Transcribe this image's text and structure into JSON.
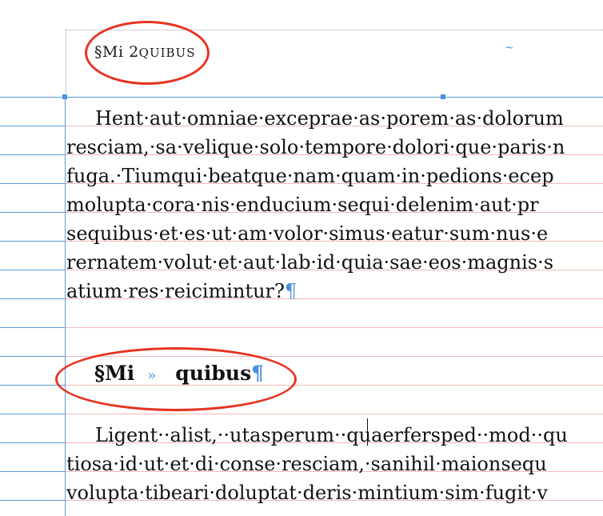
{
  "page": {
    "running_head": {
      "prefix": "§Mi 2",
      "smallcaps": "quibus"
    },
    "tilde_mark": "~"
  },
  "paragraph1": {
    "lines": [
      "Hent·aut·omniae·exceprae·as·porem·as·dolorum",
      "resciam,·sa·velique·solo·tempore·dolori·que·paris·n",
      "fuga.·Tiumqui·beatque·nam·quam·in·pedions·ecep",
      "molupta·cora·nis·enducium·sequi·delenim·aut·pr",
      "sequibus·et·es·ut·am·volor·simus·eatur·sum·nus·e",
      "rernatem·volut·et·aut·lab·id·quia·sae·eos·magnis·s",
      "atium·res·reicimintur?"
    ],
    "pilcrow": "¶"
  },
  "heading": {
    "num": "§Mi",
    "tab_mark": "»",
    "title": "quibus",
    "pilcrow": "¶"
  },
  "paragraph2": {
    "lines": [
      "Ligent··alist,··utasperum··quaerfersped··mod··qu",
      "tiosa·id·ut·et·di·conse·resciam,·sanihil·maionsequ",
      "volupta·tibeari·doluptat·deris·mintium·sim·fugit·v"
    ]
  },
  "colors": {
    "guide": "#5b9bd5",
    "baseline": "#f6b6b6",
    "highlight": "#e63322",
    "invisibles": "#4a90e2"
  }
}
